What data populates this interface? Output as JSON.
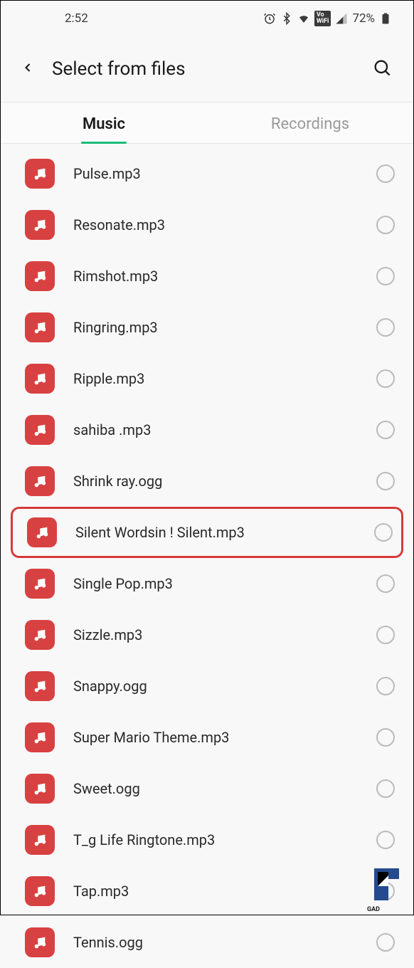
{
  "status": {
    "time": "2:52",
    "battery": "72%"
  },
  "header": {
    "title": "Select from files"
  },
  "tabs": {
    "music": "Music",
    "recordings": "Recordings"
  },
  "files": [
    {
      "name": "Pulse.mp3",
      "highlighted": false
    },
    {
      "name": "Resonate.mp3",
      "highlighted": false
    },
    {
      "name": "Rimshot.mp3",
      "highlighted": false
    },
    {
      "name": "Ringring.mp3",
      "highlighted": false
    },
    {
      "name": "Ripple.mp3",
      "highlighted": false
    },
    {
      "name": "sahiba .mp3",
      "highlighted": false
    },
    {
      "name": "Shrink ray.ogg",
      "highlighted": false
    },
    {
      "name": "Silent Wordsin ! Silent.mp3",
      "highlighted": true
    },
    {
      "name": "Single Pop.mp3",
      "highlighted": false
    },
    {
      "name": "Sizzle.mp3",
      "highlighted": false
    },
    {
      "name": "Snappy.ogg",
      "highlighted": false
    },
    {
      "name": "Super Mario Theme.mp3",
      "highlighted": false
    },
    {
      "name": "Sweet.ogg",
      "highlighted": false
    },
    {
      "name": "T_g Life Ringtone.mp3",
      "highlighted": false
    },
    {
      "name": "Tap.mp3",
      "highlighted": false
    },
    {
      "name": "Tennis.ogg",
      "highlighted": false
    }
  ]
}
